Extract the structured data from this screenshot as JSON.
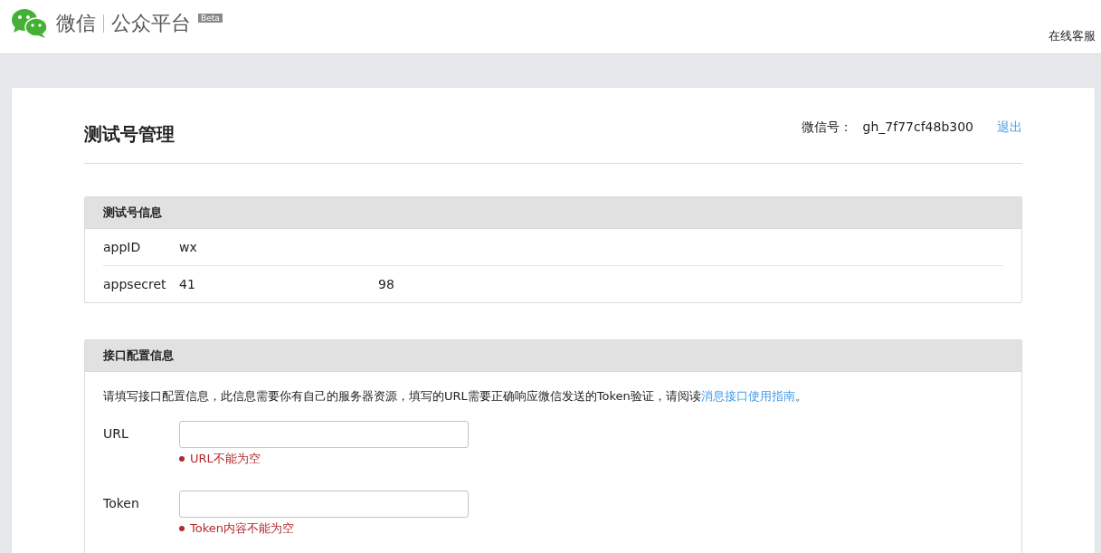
{
  "header": {
    "brand": "微信",
    "product": "公众平台",
    "badge": "Beta",
    "service_link": "在线客服"
  },
  "page": {
    "title": "测试号管理",
    "account_label": "微信号：",
    "account_id": "gh_7f77cf48b300",
    "logout": "退出"
  },
  "info_panel": {
    "title": "测试号信息",
    "rows": [
      {
        "label": "appID",
        "values": [
          "wx"
        ]
      },
      {
        "label": "appsecret",
        "values": [
          "41",
          "98"
        ]
      }
    ]
  },
  "config_panel": {
    "title": "接口配置信息",
    "intro": "请填写接口配置信息，此信息需要你有自己的服务器资源，填写的URL需要正确响应微信发送的Token验证，请阅读",
    "intro_link": "消息接口使用指南",
    "intro_end": "。",
    "fields": [
      {
        "label": "URL",
        "error": "URL不能为空"
      },
      {
        "label": "Token",
        "error": "Token内容不能为空"
      }
    ]
  }
}
